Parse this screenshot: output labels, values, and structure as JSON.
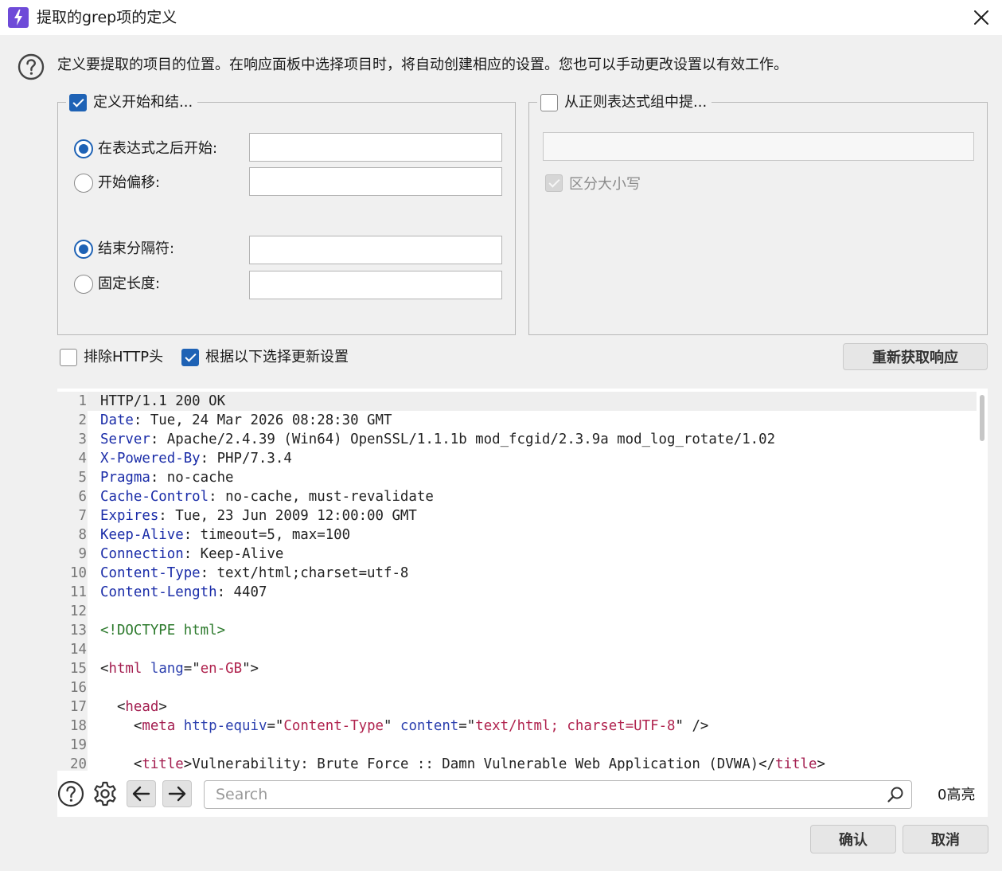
{
  "window": {
    "title": "提取的grep项的定义",
    "accent": "#6e4bd8"
  },
  "intro": "定义要提取的项目的位置。在响应面板中选择项目时，将自动创建相应的设置。您也可以手动更改设置以有效工作。",
  "left_group": {
    "legend": "定义开始和结...",
    "checked": true,
    "start_after": {
      "label": "在表达式之后开始:",
      "selected": true,
      "value": ""
    },
    "start_offset": {
      "label": "开始偏移:",
      "selected": false,
      "value": ""
    },
    "end_delimiter": {
      "label": "结束分隔符:",
      "selected": true,
      "value": ""
    },
    "fixed_length": {
      "label": "固定长度:",
      "selected": false,
      "value": ""
    }
  },
  "right_group": {
    "legend": "从正则表达式组中提...",
    "checked": false,
    "regex_value": "",
    "case_sensitive": {
      "label": "区分大小写",
      "checked": true,
      "disabled": true
    }
  },
  "options": {
    "exclude_http_headers": {
      "label": "排除HTTP头",
      "checked": false
    },
    "update_from_selection": {
      "label": "根据以下选择更新设置",
      "checked": true
    },
    "refetch_label": "重新获取响应"
  },
  "editor": {
    "lines": [
      {
        "n": "1",
        "segs": [
          {
            "t": "HTTP/1.1 200 OK",
            "c": "plain"
          }
        ]
      },
      {
        "n": "2",
        "segs": [
          {
            "t": "Date",
            "c": "hdr"
          },
          {
            "t": ": Tue, 24 Mar 2026 08:28:30 GMT",
            "c": "plain"
          }
        ]
      },
      {
        "n": "3",
        "segs": [
          {
            "t": "Server",
            "c": "hdr"
          },
          {
            "t": ": Apache/2.4.39 (Win64) OpenSSL/1.1.1b mod_fcgid/2.3.9a mod_log_rotate/1.02",
            "c": "plain"
          }
        ]
      },
      {
        "n": "4",
        "segs": [
          {
            "t": "X-Powered-By",
            "c": "hdr"
          },
          {
            "t": ": PHP/7.3.4",
            "c": "plain"
          }
        ]
      },
      {
        "n": "5",
        "segs": [
          {
            "t": "Pragma",
            "c": "hdr"
          },
          {
            "t": ": no-cache",
            "c": "plain"
          }
        ]
      },
      {
        "n": "6",
        "segs": [
          {
            "t": "Cache-Control",
            "c": "hdr"
          },
          {
            "t": ": no-cache, must-revalidate",
            "c": "plain"
          }
        ]
      },
      {
        "n": "7",
        "segs": [
          {
            "t": "Expires",
            "c": "hdr"
          },
          {
            "t": ": Tue, 23 Jun 2009 12:00:00 GMT",
            "c": "plain"
          }
        ]
      },
      {
        "n": "8",
        "segs": [
          {
            "t": "Keep-Alive",
            "c": "hdr"
          },
          {
            "t": ": timeout=5, max=100",
            "c": "plain"
          }
        ]
      },
      {
        "n": "9",
        "segs": [
          {
            "t": "Connection",
            "c": "hdr"
          },
          {
            "t": ": Keep-Alive",
            "c": "plain"
          }
        ]
      },
      {
        "n": "10",
        "segs": [
          {
            "t": "Content-Type",
            "c": "hdr"
          },
          {
            "t": ": text/html;charset=utf-8",
            "c": "plain"
          }
        ]
      },
      {
        "n": "11",
        "segs": [
          {
            "t": "Content-Length",
            "c": "hdr"
          },
          {
            "t": ": 4407",
            "c": "plain"
          }
        ]
      },
      {
        "n": "12",
        "segs": []
      },
      {
        "n": "13",
        "segs": [
          {
            "t": "<!DOCTYPE html>",
            "c": "doctype"
          }
        ]
      },
      {
        "n": "14",
        "segs": []
      },
      {
        "n": "15",
        "segs": [
          {
            "t": "<",
            "c": "plain"
          },
          {
            "t": "html",
            "c": "tag"
          },
          {
            "t": " ",
            "c": "plain"
          },
          {
            "t": "lang",
            "c": "attr"
          },
          {
            "t": "=\"",
            "c": "plain"
          },
          {
            "t": "en-GB",
            "c": "str"
          },
          {
            "t": "\">",
            "c": "plain"
          }
        ]
      },
      {
        "n": "16",
        "segs": []
      },
      {
        "n": "17",
        "segs": [
          {
            "t": "  <",
            "c": "plain"
          },
          {
            "t": "head",
            "c": "tag"
          },
          {
            "t": ">",
            "c": "plain"
          }
        ]
      },
      {
        "n": "18",
        "segs": [
          {
            "t": "    <",
            "c": "plain"
          },
          {
            "t": "meta",
            "c": "tag"
          },
          {
            "t": " ",
            "c": "plain"
          },
          {
            "t": "http-equiv",
            "c": "attr"
          },
          {
            "t": "=\"",
            "c": "plain"
          },
          {
            "t": "Content-Type",
            "c": "str"
          },
          {
            "t": "\" ",
            "c": "plain"
          },
          {
            "t": "content",
            "c": "attr"
          },
          {
            "t": "=\"",
            "c": "plain"
          },
          {
            "t": "text/html; charset=UTF-8",
            "c": "str"
          },
          {
            "t": "\" />",
            "c": "plain"
          }
        ]
      },
      {
        "n": "19",
        "segs": []
      },
      {
        "n": "20",
        "segs": [
          {
            "t": "    <",
            "c": "plain"
          },
          {
            "t": "title",
            "c": "tag"
          },
          {
            "t": ">Vulnerability: Brute Force :: Damn Vulnerable Web Application (DVWA)</",
            "c": "plain"
          },
          {
            "t": "title",
            "c": "tag"
          },
          {
            "t": ">",
            "c": "plain"
          }
        ]
      }
    ]
  },
  "search": {
    "placeholder": "Search",
    "value": "",
    "match_count": "0高亮"
  },
  "footer": {
    "ok_label": "确认",
    "cancel_label": "取消"
  },
  "icons": {
    "app": "burp-lightning-icon",
    "close": "close-icon",
    "help": "help-icon",
    "settings": "gear-icon",
    "prev": "arrow-left-icon",
    "next": "arrow-right-icon",
    "search": "search-icon"
  }
}
